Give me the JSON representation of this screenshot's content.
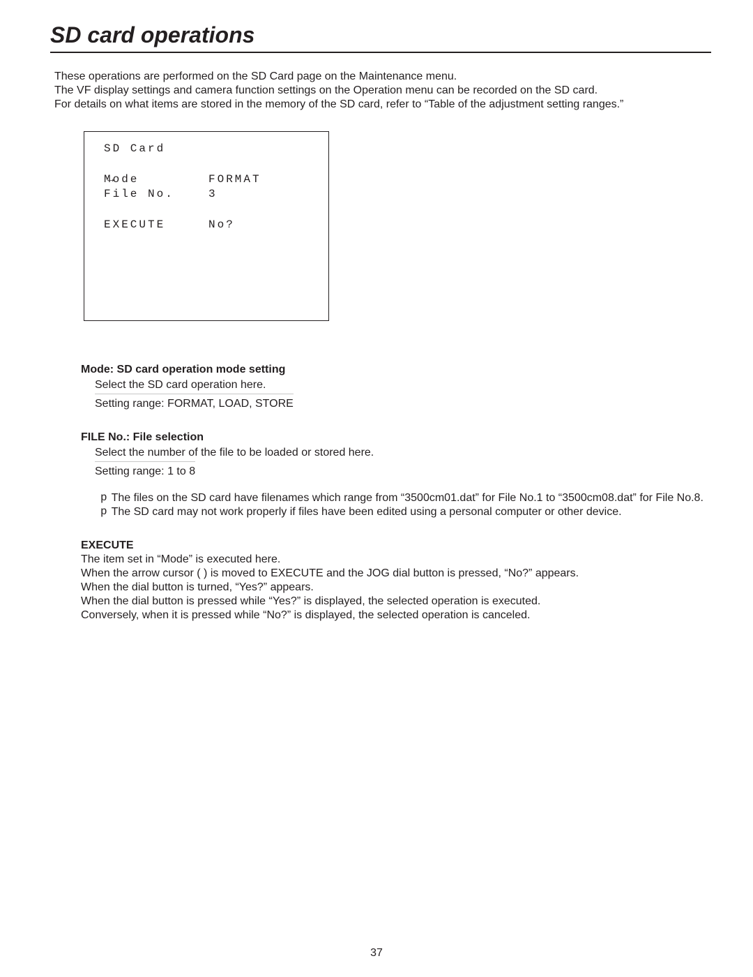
{
  "page": {
    "title": "SD card operations",
    "intro_lines": [
      "These operations are performed on the SD Card page on the Maintenance menu.",
      "The VF display settings and camera function settings on the Operation menu can be recorded on the SD card.",
      "For details on what items are stored in the memory of the SD card, refer to “Table of the adjustment setting ranges.”"
    ],
    "page_number": "37"
  },
  "lcd": {
    "header": "SD Card",
    "arrow": "→",
    "row1_left": "Mode",
    "row1_right": "FORMAT",
    "row2_left": "File No.",
    "row2_right": "3",
    "row3_left": "EXECUTE",
    "row3_right": "No?"
  },
  "mode": {
    "title": "Mode: SD card operation mode setting",
    "sub": "Select the SD card operation here.",
    "range": "Setting range: FORMAT, LOAD, STORE"
  },
  "fileno": {
    "title": "FILE No.: File selection",
    "sub": "Select the number of the file to be loaded or stored here.",
    "range": "Setting range: 1 to 8",
    "notes": [
      "The files on the SD card have filenames which range from “3500cm01.dat” for File No.1 to “3500cm08.dat” for File No.8.",
      "The SD card may not work properly if files have been edited using a personal computer or other device."
    ],
    "bullet": "p"
  },
  "execute": {
    "title": "EXECUTE",
    "lines": [
      "The item set in “Mode” is executed here.",
      "When the arrow cursor (  ) is moved to EXECUTE and the JOG dial button is pressed, “No?” appears.",
      "When the dial button is turned, “Yes?” appears.",
      "When the dial button is pressed while “Yes?” is displayed, the selected operation is executed.",
      "Conversely, when it is pressed while “No?” is displayed, the selected operation is canceled."
    ]
  }
}
